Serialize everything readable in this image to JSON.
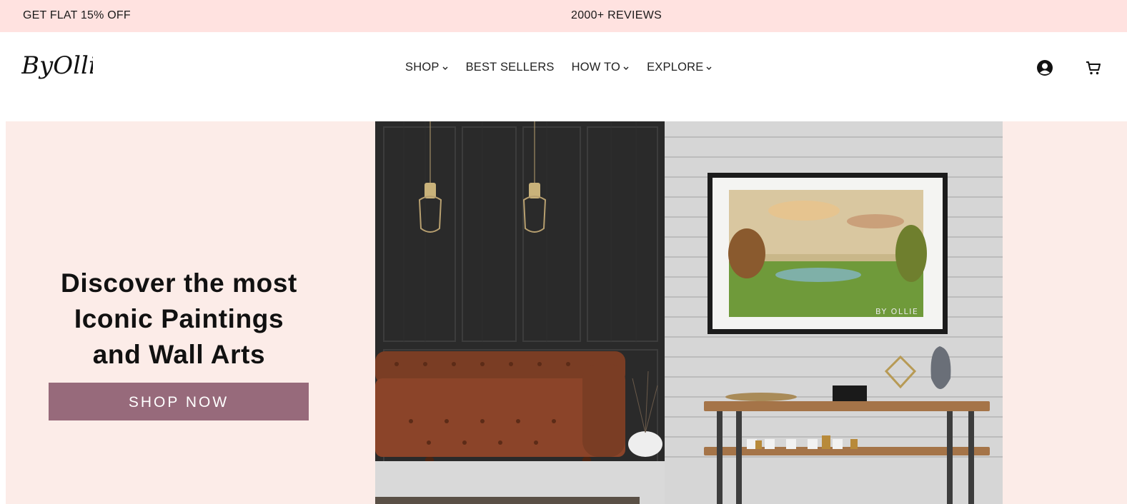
{
  "announcement": {
    "promo": "GET FLAT 15% OFF",
    "reviews": "2000+ REVIEWS"
  },
  "header": {
    "logo_text": "ByOllie",
    "nav": [
      {
        "label": "SHOP",
        "has_dropdown": true
      },
      {
        "label": "BEST SELLERS",
        "has_dropdown": false
      },
      {
        "label": "HOW TO",
        "has_dropdown": true
      },
      {
        "label": "EXPLORE",
        "has_dropdown": true
      }
    ],
    "icons": [
      "account-icon",
      "cart-icon"
    ]
  },
  "hero": {
    "title_lines": [
      "Discover the most",
      "Iconic Paintings",
      "and Wall Arts"
    ],
    "cta_label": "SHOP NOW",
    "painting_watermark": "BY OLLIE"
  },
  "colors": {
    "announcement_bg": "#ffe2e0",
    "hero_bg": "#fcece8",
    "cta_bg": "#976a7b",
    "cta_text": "#ffffff"
  }
}
